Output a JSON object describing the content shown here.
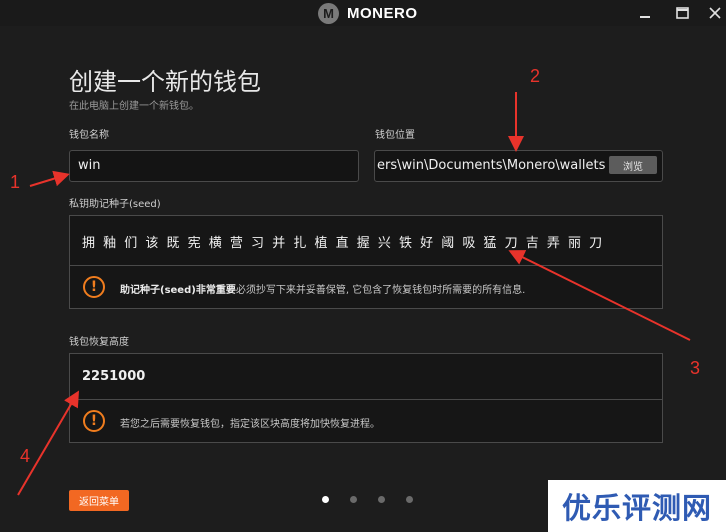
{
  "app": {
    "name": "MONERO",
    "logo_letter": "M",
    "window_controls": {
      "minimize": "—",
      "maximize": "☐",
      "close": "✕"
    }
  },
  "page": {
    "title": "创建一个新的钱包",
    "subtitle": "在此电脑上创建一个新钱包。"
  },
  "wallet_name": {
    "label": "钱包名称",
    "value": "win"
  },
  "wallet_location": {
    "label": "钱包位置",
    "value": "ers\\win\\Documents\\Monero\\wallets",
    "browse_label": "浏览"
  },
  "seed": {
    "label": "私钥助记种子(seed)",
    "words": "拥 釉 们 该 既 宪 横 营 习 并 扎 植 直 握 兴 铁 好 阈 吸 猛 刀 吉 弄 丽 刀",
    "warning_icon": "!",
    "warning_bold": "助记种子(seed)非常重要",
    "warning_rest": "必须抄写下来并妥善保管, 它包含了恢复钱包时所需要的所有信息."
  },
  "restore_height": {
    "label": "钱包恢复高度",
    "value": "2251000",
    "warning_icon": "!",
    "warning": "若您之后需要恢复钱包，指定该区块高度将加快恢复进程。"
  },
  "footer": {
    "back_label": "返回菜单",
    "pages": [
      {
        "active": true
      },
      {
        "active": false
      },
      {
        "active": false
      },
      {
        "active": false
      }
    ]
  },
  "annotations": {
    "n1": "1",
    "n2": "2",
    "n3": "3",
    "n4": "4",
    "color": "#e8332b"
  },
  "watermark": {
    "text": "优乐评测网"
  },
  "colors": {
    "background": "#1d1d1d",
    "accent": "#f26822",
    "warning": "#f07d1e"
  }
}
